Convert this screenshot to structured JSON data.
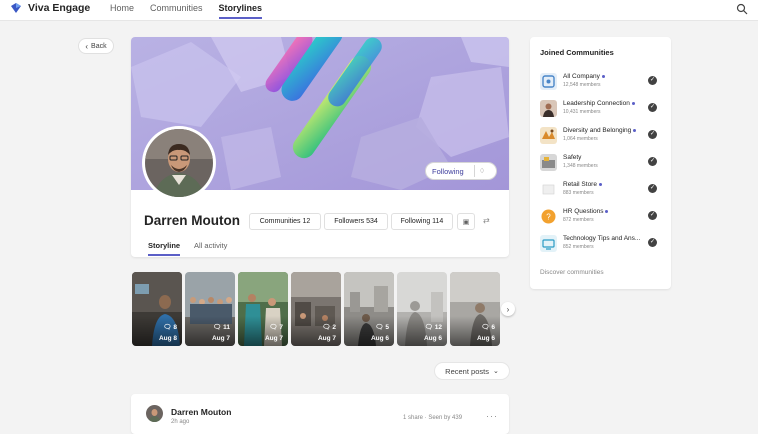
{
  "app": {
    "name": "Viva Engage",
    "accent": "#5b5fc7"
  },
  "nav": {
    "items": [
      {
        "label": "Home"
      },
      {
        "label": "Communities"
      },
      {
        "label": "Storylines"
      }
    ]
  },
  "back": {
    "label": "Back"
  },
  "profile": {
    "name": "Darren Mouton",
    "following_label": "Following",
    "stats": {
      "communities": "Communities 12",
      "followers": "Followers 534",
      "following": "Following 114"
    },
    "tabs": [
      {
        "label": "Storyline"
      },
      {
        "label": "All activity"
      }
    ]
  },
  "media": [
    {
      "count": "8",
      "date": "Aug 8"
    },
    {
      "count": "11",
      "date": "Aug 7"
    },
    {
      "count": "7",
      "date": "Aug 7"
    },
    {
      "count": "2",
      "date": "Aug 7"
    },
    {
      "count": "5",
      "date": "Aug 6"
    },
    {
      "count": "12",
      "date": "Aug 6"
    },
    {
      "count": "6",
      "date": "Aug 6"
    }
  ],
  "feed": {
    "sort_label": "Recent posts"
  },
  "post": {
    "author": "Darren Mouton",
    "time": "2h ago",
    "meta": "1 share · Seen by 439"
  },
  "sidebar": {
    "title": "Joined Communities",
    "communities": [
      {
        "name": "All Company",
        "members": "12,548 members",
        "unread": true
      },
      {
        "name": "Leadership Connection",
        "members": "10,431 members",
        "unread": true
      },
      {
        "name": "Diversity and Belonging",
        "members": "1,064 members",
        "unread": true
      },
      {
        "name": "Safety",
        "members": "1,348 members",
        "unread": false
      },
      {
        "name": "Retail Store",
        "members": "883 members",
        "unread": true
      },
      {
        "name": "HR Questions",
        "members": "872 members",
        "unread": true
      },
      {
        "name": "Technology Tips and Ans...",
        "members": "852 members",
        "unread": false
      }
    ],
    "discover_label": "Discover communities"
  }
}
